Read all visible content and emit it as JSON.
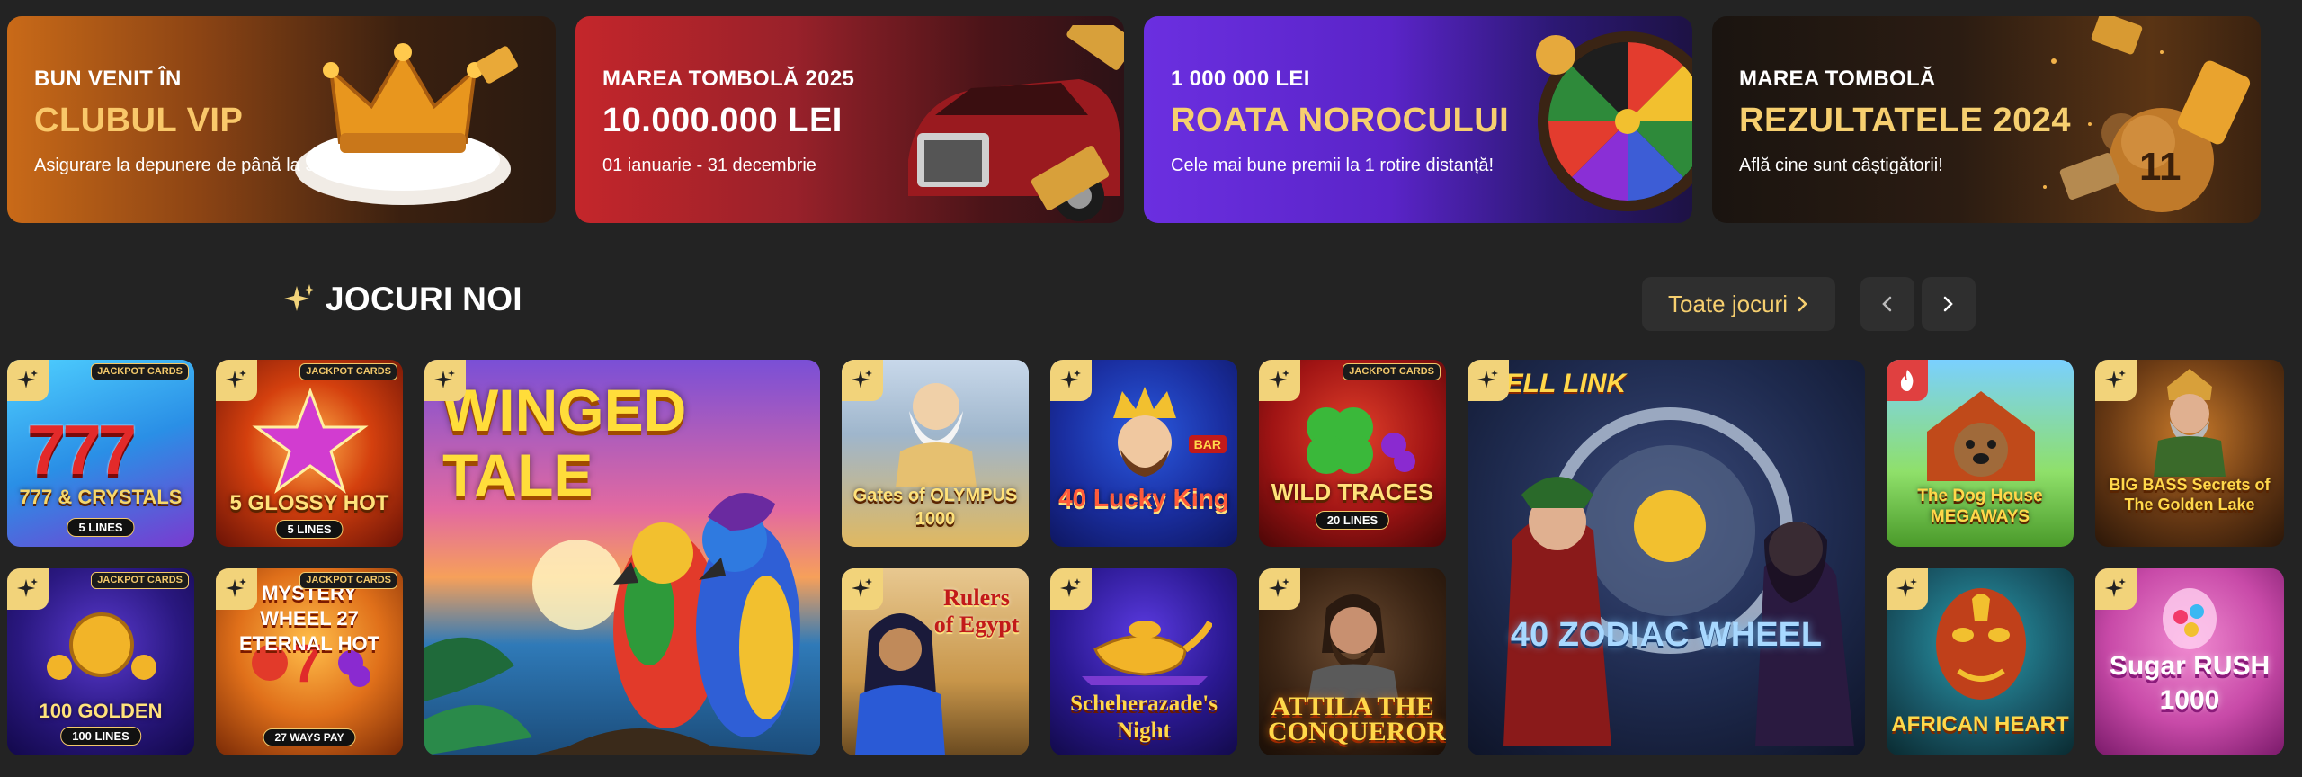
{
  "banners": [
    {
      "eyebrow": "BUN VENIT ÎN",
      "headline": "CLUBUL VIP",
      "sub": "Asigurare la depunere de până la 30%"
    },
    {
      "eyebrow": "MAREA TOMBOLĂ 2025",
      "headline": "10.000.000 LEI",
      "sub": "01 ianuarie - 31 decembrie"
    },
    {
      "eyebrow": "1 000 000 LEI",
      "headline": "ROATA NOROCULUI",
      "sub": "Cele mai bune premii la 1 rotire distanță!"
    },
    {
      "eyebrow": "MAREA TOMBOLĂ",
      "headline": "REZULTATELE 2024",
      "sub": "Află cine sunt câștigătorii!"
    }
  ],
  "section": {
    "title": "JOCURI NOI",
    "see_all": "Toate jocuri"
  },
  "badges": {
    "jackpot": "JACKPOT CARDS"
  },
  "games": [
    {
      "title": "777 & CRYSTALS",
      "lines": "5 LINES"
    },
    {
      "title": "5 GLOSSY HOT",
      "lines": "5 LINES"
    },
    {
      "title": "WINGED TALE"
    },
    {
      "title": "Gates of OLYMPUS 1000"
    },
    {
      "title": "40 Lucky King",
      "tag": "BAR"
    },
    {
      "title": "WILD TRACES",
      "lines": "20 LINES"
    },
    {
      "title": "40 ZODIAC WHEEL",
      "tag": "BELL LINK"
    },
    {
      "title": "The Dog House MEGAWAYS"
    },
    {
      "title": "BIG BASS Secrets of The Golden Lake"
    },
    {
      "title": "100 GOLDEN COINS",
      "lines": "100 LINES"
    },
    {
      "title": "MYSTERY WHEEL 27 ETERNAL HOT",
      "lines": "27 WAYS PAY"
    },
    {
      "title": "Rulers of Egypt"
    },
    {
      "title": "Scheherazade's Night"
    },
    {
      "title": "ATTILA THE CONQUEROR"
    },
    {
      "title": "AFRICAN HEART"
    },
    {
      "title": "Sugar RUSH 1000"
    }
  ]
}
